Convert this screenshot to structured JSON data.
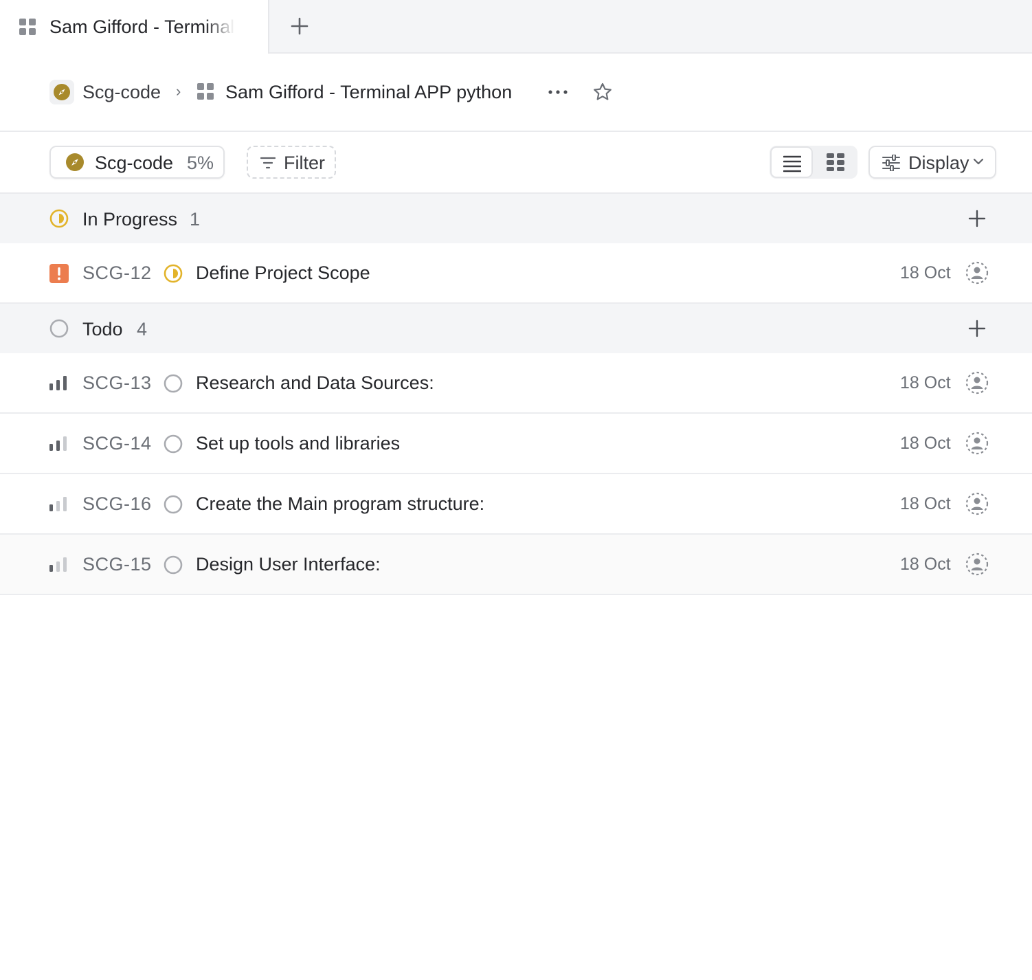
{
  "tab": {
    "title": "Sam Gifford - Terminal APP python",
    "new_tab_icon": "plus-icon"
  },
  "breadcrumb": {
    "project": "Scg-code",
    "separator": "›",
    "page": "Sam Gifford - Terminal APP python",
    "more_icon": "more-horizontal-icon",
    "favorite_icon": "star-icon"
  },
  "toolbar": {
    "project_chip": {
      "name": "Scg-code",
      "progress": "5%"
    },
    "filter_label": "Filter",
    "view_modes": [
      "list",
      "board"
    ],
    "active_view": "list",
    "display_label": "Display"
  },
  "groups": [
    {
      "name": "In Progress",
      "count": "1",
      "status": "in-progress",
      "issues": [
        {
          "id": "SCG-12",
          "title": "Define Project Scope",
          "date": "18 Oct",
          "priority": "urgent",
          "status": "in-progress"
        }
      ]
    },
    {
      "name": "Todo",
      "count": "4",
      "status": "todo",
      "issues": [
        {
          "id": "SCG-13",
          "title": "Research and Data Sources:",
          "date": "18 Oct",
          "priority": "high",
          "status": "todo"
        },
        {
          "id": "SCG-14",
          "title": "Set up tools and libraries",
          "date": "18 Oct",
          "priority": "medium",
          "status": "todo"
        },
        {
          "id": "SCG-16",
          "title": "Create the Main program structure:",
          "date": "18 Oct",
          "priority": "low",
          "status": "todo"
        },
        {
          "id": "SCG-15",
          "title": "Design User Interface:",
          "date": "18 Oct",
          "priority": "low",
          "status": "todo"
        }
      ]
    }
  ],
  "colors": {
    "accent_project": "#a88a2c",
    "in_progress": "#e2b32a",
    "urgent": "#ec7d4f",
    "todo_circle": "#a9abb0",
    "group_bg": "#f4f5f7"
  }
}
